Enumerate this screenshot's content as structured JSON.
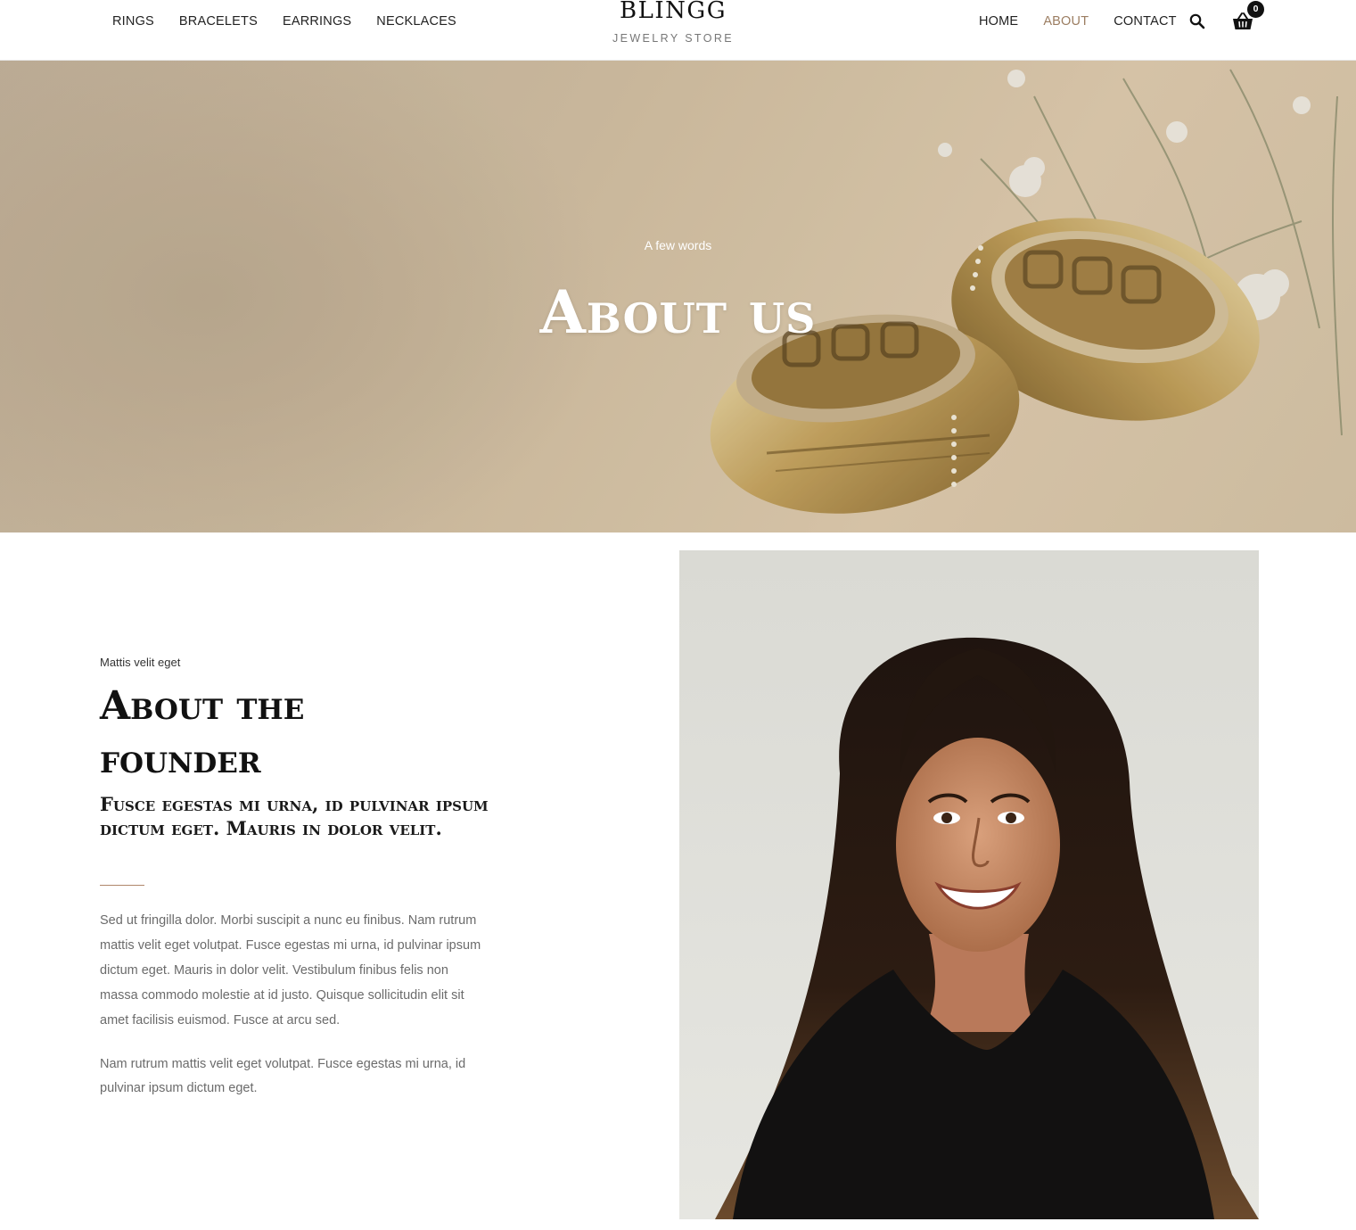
{
  "header": {
    "nav_left": [
      "RINGS",
      "BRACELETS",
      "EARRINGS",
      "NECKLACES"
    ],
    "brand_name": "BLINGG",
    "brand_sub": "JEWELRY STORE",
    "nav_right": [
      {
        "label": "HOME",
        "active": false
      },
      {
        "label": "ABOUT",
        "active": true
      },
      {
        "label": "CONTACT",
        "active": false
      }
    ],
    "search_icon": "search-icon",
    "cart_icon": "basket-icon",
    "cart_count": "0",
    "active_color": "#9c7e62"
  },
  "hero": {
    "kicker": "A few words",
    "title": "About us",
    "image": "two gold wedding rings with baby's breath flowers"
  },
  "founder": {
    "kicker": "Mattis velit eget",
    "title": "About the founder",
    "subtitle": "Fusce egestas mi urna, id pulvinar ipsum dictum eget. Mauris in dolor velit.",
    "paragraph1": "Sed ut fringilla dolor. Morbi suscipit a nunc eu finibus. Nam rutrum mattis velit eget volutpat. Fusce egestas mi urna, id pulvinar ipsum dictum eget. Mauris in dolor velit. Vestibulum finibus felis non massa commodo molestie at id justo. Quisque sollicitudin elit sit amet facilisis euismod. Fusce at arcu sed.",
    "paragraph2": "Nam rutrum mattis velit eget volutpat. Fusce egestas mi urna, id pulvinar ipsum dictum eget.",
    "divider_color": "#b0876a",
    "image": "smiling woman with long dark hair in a black top"
  }
}
